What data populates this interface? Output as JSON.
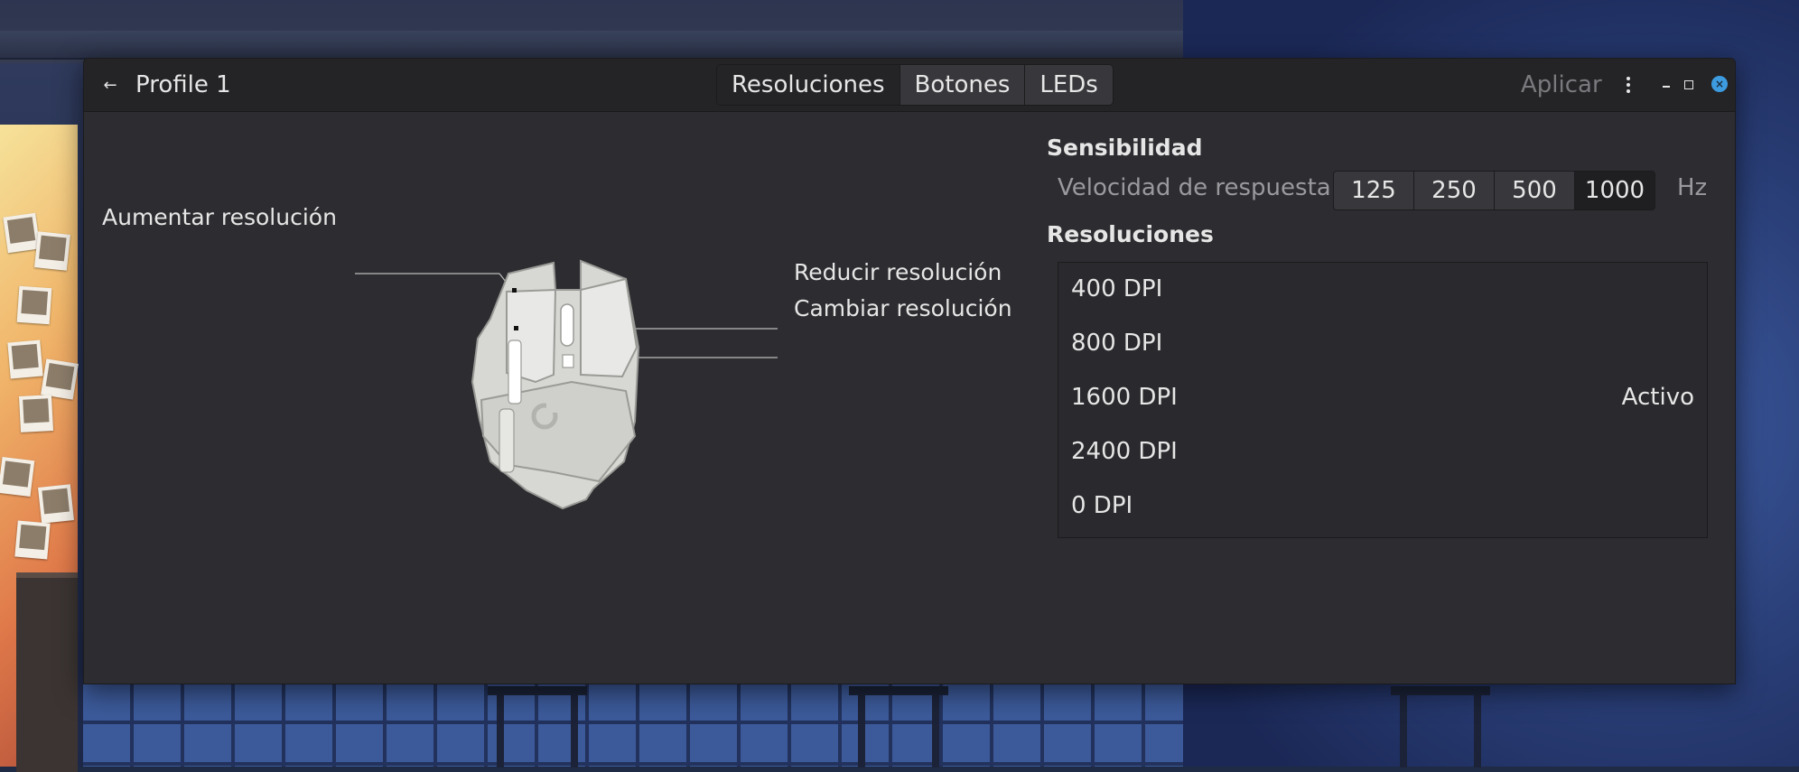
{
  "window": {
    "title": "Profile 1",
    "tabs": [
      {
        "label": "Resoluciones",
        "active": true
      },
      {
        "label": "Botones",
        "active": false
      },
      {
        "label": "LEDs",
        "active": false
      }
    ],
    "apply_label": "Aplicar",
    "apply_enabled": false
  },
  "diagram": {
    "callouts": {
      "increase": "Aumentar resolución",
      "decrease": "Reducir resolución",
      "cycle": "Cambiar resolución"
    }
  },
  "sensitivity": {
    "title": "Sensibilidad",
    "polling_label": "Velocidad de respuesta",
    "polling_options": [
      "125",
      "250",
      "500",
      "1000"
    ],
    "polling_selected": "1000",
    "polling_unit": "Hz"
  },
  "resolutions": {
    "title": "Resoluciones",
    "items": [
      {
        "label": "400 DPI",
        "state": ""
      },
      {
        "label": "800 DPI",
        "state": ""
      },
      {
        "label": "1600 DPI",
        "state": "Activo"
      },
      {
        "label": "2400 DPI",
        "state": ""
      },
      {
        "label": "0 DPI",
        "state": ""
      }
    ]
  },
  "icons": {
    "back": "back-arrow-icon",
    "menu": "vertical-ellipsis-icon",
    "minimize": "minimize-icon",
    "maximize": "maximize-icon",
    "close": "close-icon"
  },
  "colors": {
    "window_bg": "#2d2d31",
    "titlebar_bg": "#242427",
    "close_accent": "#3d9be0",
    "mouse_body": "#d7d8d4"
  }
}
